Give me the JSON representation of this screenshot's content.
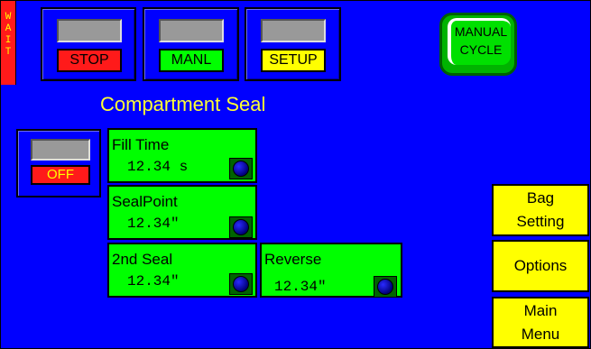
{
  "status": {
    "wait_letters": [
      "W",
      "A",
      "I",
      "T"
    ]
  },
  "modes": [
    {
      "label": "STOP",
      "color": "#ff1a1a"
    },
    {
      "label": "MANL",
      "color": "#00ff00"
    },
    {
      "label": "SETUP",
      "color": "#ffff00"
    }
  ],
  "cycle_button": {
    "line1": "MANUAL",
    "line2": "CYCLE"
  },
  "screen_title": "Compartment Seal",
  "off_button": {
    "label": "OFF"
  },
  "params": [
    {
      "label": "Fill Time",
      "value": "12.34 s"
    },
    {
      "label": "SealPoint",
      "value": "12.34\""
    },
    {
      "label": "2nd Seal",
      "value": "12.34\""
    },
    {
      "label": "Reverse",
      "value": "12.34\""
    }
  ],
  "nav": {
    "bag_setting": {
      "line1": "Bag",
      "line2": "Setting"
    },
    "options": {
      "label": "Options"
    },
    "main_menu": {
      "line1": "Main",
      "line2": "Menu"
    }
  }
}
